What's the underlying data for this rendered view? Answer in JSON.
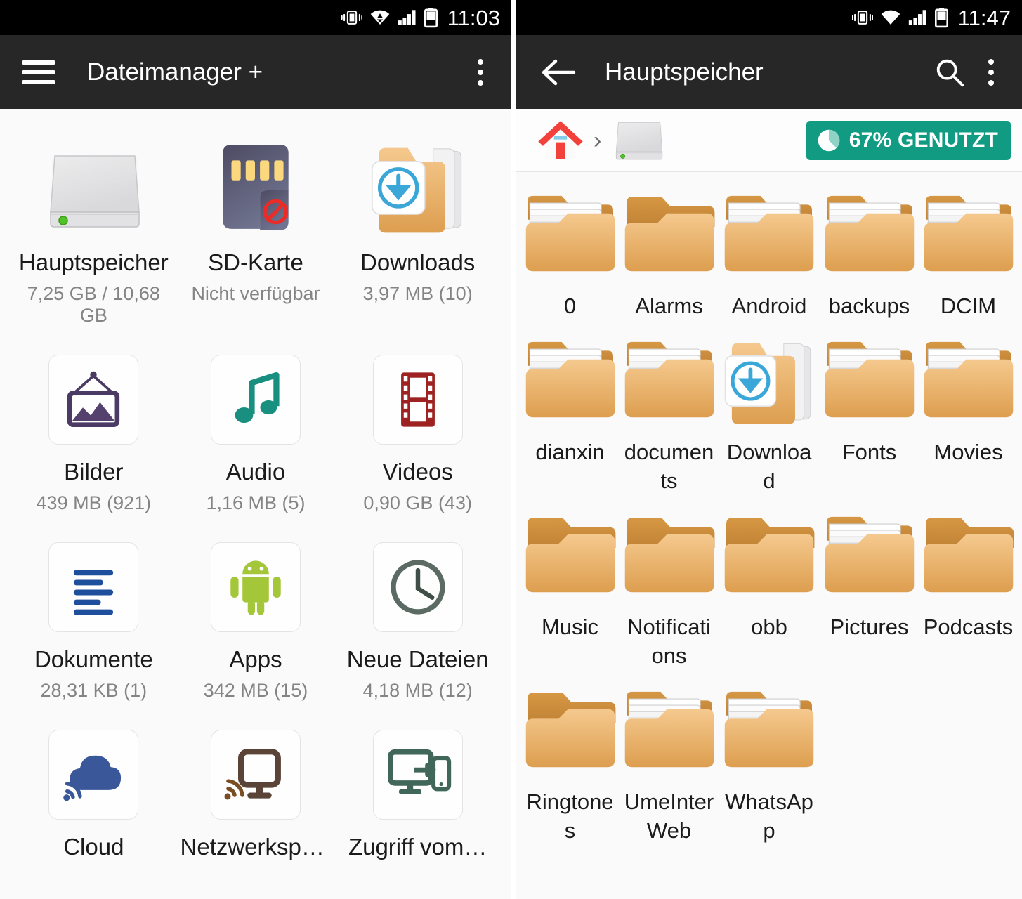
{
  "left": {
    "statusbar": {
      "time": "11:03",
      "icons": [
        "vibrate-icon",
        "wifi-triangle-icon",
        "signal-icon",
        "battery-icon"
      ]
    },
    "toolbar": {
      "menu_icon": "hamburger-icon",
      "title": "Dateimanager +",
      "overflow_icon": "kebab-menu-icon"
    },
    "tiles": [
      {
        "icon": "hard-drive-icon",
        "name": "Hauptspeicher",
        "sub": "7,25 GB / 10,68 GB"
      },
      {
        "icon": "sd-card-blocked-icon",
        "name": "SD-Karte",
        "sub": "Nicht verfügbar"
      },
      {
        "icon": "downloads-folder-icon",
        "name": "Downloads",
        "sub": "3,97 MB (10)"
      },
      {
        "icon": "picture-frame-icon",
        "name": "Bilder",
        "sub": "439 MB (921)"
      },
      {
        "icon": "music-note-icon",
        "name": "Audio",
        "sub": "1,16 MB (5)"
      },
      {
        "icon": "film-strip-icon",
        "name": "Videos",
        "sub": "0,90 GB (43)"
      },
      {
        "icon": "document-lines-icon",
        "name": "Dokumente",
        "sub": "28,31 KB (1)"
      },
      {
        "icon": "android-robot-icon",
        "name": "Apps",
        "sub": "342 MB (15)"
      },
      {
        "icon": "clock-icon",
        "name": "Neue Dateien",
        "sub": "4,18 MB (12)"
      },
      {
        "icon": "cloud-wifi-icon",
        "name": "Cloud",
        "sub": ""
      },
      {
        "icon": "network-storage-icon",
        "name": "Netzwerkspe…",
        "sub": ""
      },
      {
        "icon": "remote-access-icon",
        "name": "Zugriff vom…",
        "sub": ""
      }
    ]
  },
  "right": {
    "statusbar": {
      "time": "11:47",
      "icons": [
        "vibrate-icon",
        "wifi-icon",
        "signal-icon",
        "battery-icon"
      ]
    },
    "toolbar": {
      "back_icon": "back-arrow-icon",
      "title": "Hauptspeicher",
      "search_icon": "search-icon",
      "overflow_icon": "kebab-menu-icon"
    },
    "breadcrumb": {
      "items": [
        {
          "icon": "home-icon",
          "label": ""
        },
        {
          "icon": "hard-drive-icon",
          "label": ""
        }
      ],
      "separator": "›"
    },
    "usage_badge": {
      "icon": "pie-chart-icon",
      "label": "67% GENUTZT",
      "percent": 67,
      "color": "#109b82"
    },
    "folders": [
      {
        "name": "0",
        "type": "folder-with-files"
      },
      {
        "name": "Alarms",
        "type": "folder-empty"
      },
      {
        "name": "Android",
        "type": "folder-with-files"
      },
      {
        "name": "backups",
        "type": "folder-with-files"
      },
      {
        "name": "DCIM",
        "type": "folder-with-files"
      },
      {
        "name": "dianxin",
        "type": "folder-with-files"
      },
      {
        "name": "documents",
        "type": "folder-with-files"
      },
      {
        "name": "Download",
        "type": "folder-download"
      },
      {
        "name": "Fonts",
        "type": "folder-with-files"
      },
      {
        "name": "Movies",
        "type": "folder-with-files"
      },
      {
        "name": "Music",
        "type": "folder-empty"
      },
      {
        "name": "Notifications",
        "type": "folder-empty"
      },
      {
        "name": "obb",
        "type": "folder-empty"
      },
      {
        "name": "Pictures",
        "type": "folder-with-files"
      },
      {
        "name": "Podcasts",
        "type": "folder-empty"
      },
      {
        "name": "Ringtones",
        "type": "folder-empty"
      },
      {
        "name": "UmeInterWeb",
        "type": "folder-with-files"
      },
      {
        "name": "WhatsApp",
        "type": "folder-with-files"
      }
    ]
  },
  "colors": {
    "statusbar_bg": "#000000",
    "toolbar_bg": "#272727",
    "page_bg": "#fafafb",
    "badge_teal": "#109b82",
    "folder_front": "#efbc7d",
    "folder_back": "#c8893c",
    "accent_blue": "#3aa7d8"
  }
}
